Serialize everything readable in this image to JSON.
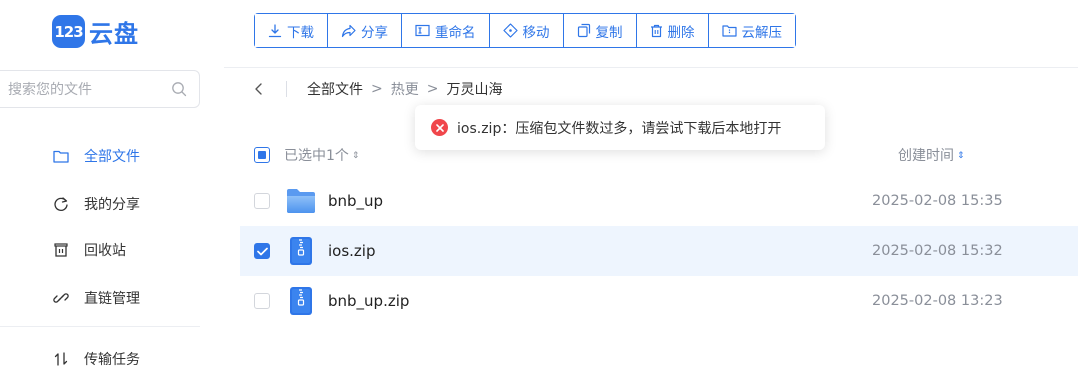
{
  "app": {
    "logo_mark": "123",
    "logo_text": "云盘"
  },
  "search": {
    "placeholder": "搜索您的文件"
  },
  "sidebar": {
    "items": [
      {
        "label": "全部文件",
        "icon": "folder-icon",
        "active": true
      },
      {
        "label": "我的分享",
        "icon": "share-icon"
      },
      {
        "label": "回收站",
        "icon": "trash-icon"
      },
      {
        "label": "直链管理",
        "icon": "link-icon"
      },
      {
        "label": "传输任务",
        "icon": "transfer-icon"
      }
    ]
  },
  "toolbar": {
    "download": "下载",
    "share": "分享",
    "rename": "重命名",
    "move": "移动",
    "copy": "复制",
    "delete": "删除",
    "extract": "云解压"
  },
  "breadcrumb": {
    "root": "全部文件",
    "level1": "热更",
    "current": "万灵山海"
  },
  "table": {
    "selection_text": "已选中1个",
    "col_created": "创建时间",
    "rows": [
      {
        "name": "bnb_up",
        "type": "folder",
        "created": "2025-02-08 15:35",
        "checked": false
      },
      {
        "name": "ios.zip",
        "type": "zip",
        "created": "2025-02-08 15:32",
        "checked": true
      },
      {
        "name": "bnb_up.zip",
        "type": "zip",
        "created": "2025-02-08 13:23",
        "checked": false
      }
    ]
  },
  "toast": {
    "message": "ios.zip：压缩包文件数过多，请尝试下载后本地打开",
    "icon": "error-icon"
  },
  "colors": {
    "accent": "#2f76e8",
    "error": "#f0464b",
    "selected_row": "#eef5fe"
  }
}
